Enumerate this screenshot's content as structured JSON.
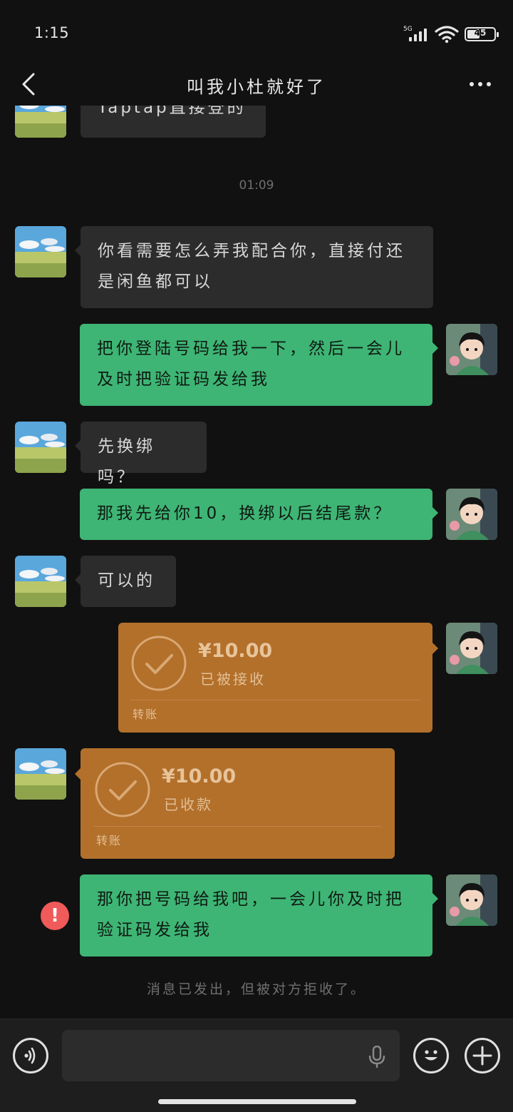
{
  "status_bar": {
    "time": "1:15",
    "network": "5G",
    "battery": "45"
  },
  "header": {
    "title": "叫我小杜就好了"
  },
  "messages": {
    "partial_top": "Taptap直接登的",
    "timestamp": "01:09",
    "m1": "你看需要怎么弄我配合你，直接付还是闲鱼都可以",
    "m2": "把你登陆号码给我一下，然后一会儿及时把验证码发给我",
    "m3": "先换绑吗？",
    "m4": "那我先给你10，换绑以后结尾款？",
    "m5": "可以的",
    "transfer_out": {
      "amount": "¥10.00",
      "status": "已被接收",
      "label": "转账"
    },
    "transfer_in": {
      "amount": "¥10.00",
      "status": "已收款",
      "label": "转账"
    },
    "m6": "那你把号码给我吧，一会儿你及时把验证码发给我",
    "failed_badge": "!",
    "notice": "消息已发出，但被对方拒收了。"
  },
  "input": {
    "value": ""
  },
  "colors": {
    "background": "#111111",
    "incoming_bubble": "#2c2c2c",
    "outgoing_bubble": "#3eb575",
    "transfer": "#b3702b",
    "error": "#f05a5a"
  }
}
